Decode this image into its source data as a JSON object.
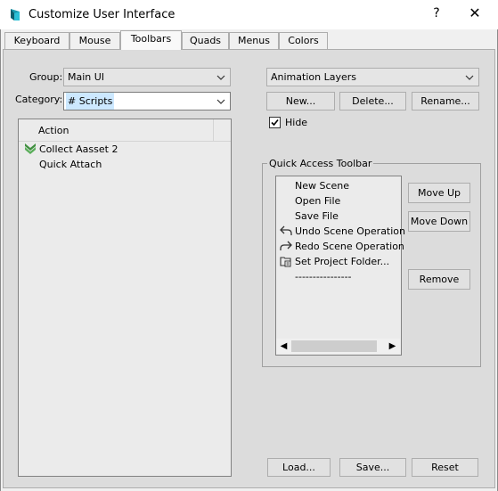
{
  "window": {
    "title": "Customize User Interface",
    "help_label": "?",
    "close_label": "✕"
  },
  "tabs": [
    {
      "label": "Keyboard",
      "active": false
    },
    {
      "label": "Mouse",
      "active": false
    },
    {
      "label": "Toolbars",
      "active": true
    },
    {
      "label": "Quads",
      "active": false
    },
    {
      "label": "Menus",
      "active": false
    },
    {
      "label": "Colors",
      "active": false
    }
  ],
  "left": {
    "group_label": "Group:",
    "group_value": "Main UI",
    "category_label": "Category:",
    "category_value": "# Scripts",
    "list_header": "Action",
    "actions": [
      {
        "label": "Collect Aasset 2",
        "icon": "double-chevron-down-icon"
      },
      {
        "label": "Quick Attach",
        "icon": ""
      }
    ]
  },
  "right": {
    "toolbar_value": "Animation Layers",
    "new_label": "New...",
    "delete_label": "Delete...",
    "rename_label": "Rename...",
    "hide_label": "Hide",
    "hide_checked": true,
    "qat_title": "Quick Access Toolbar",
    "qat_items": [
      {
        "label": "New Scene",
        "icon": ""
      },
      {
        "label": "Open File",
        "icon": ""
      },
      {
        "label": "Save File",
        "icon": ""
      },
      {
        "label": "Undo Scene Operation",
        "icon": "undo-icon"
      },
      {
        "label": "Redo Scene Operation",
        "icon": "redo-icon"
      },
      {
        "label": "Set Project Folder...",
        "icon": "project-folder-icon"
      },
      {
        "label": "----------------",
        "icon": ""
      }
    ],
    "move_up_label": "Move Up",
    "move_down_label": "Move Down",
    "remove_label": "Remove"
  },
  "footer": {
    "load_label": "Load...",
    "save_label": "Save...",
    "reset_label": "Reset"
  },
  "colors": {
    "accent_icon": "#1b9bb0",
    "chevron_green": "#3f8f3f",
    "panel_bg": "#dcdcdc",
    "selected_highlight": "#cce8ff"
  }
}
